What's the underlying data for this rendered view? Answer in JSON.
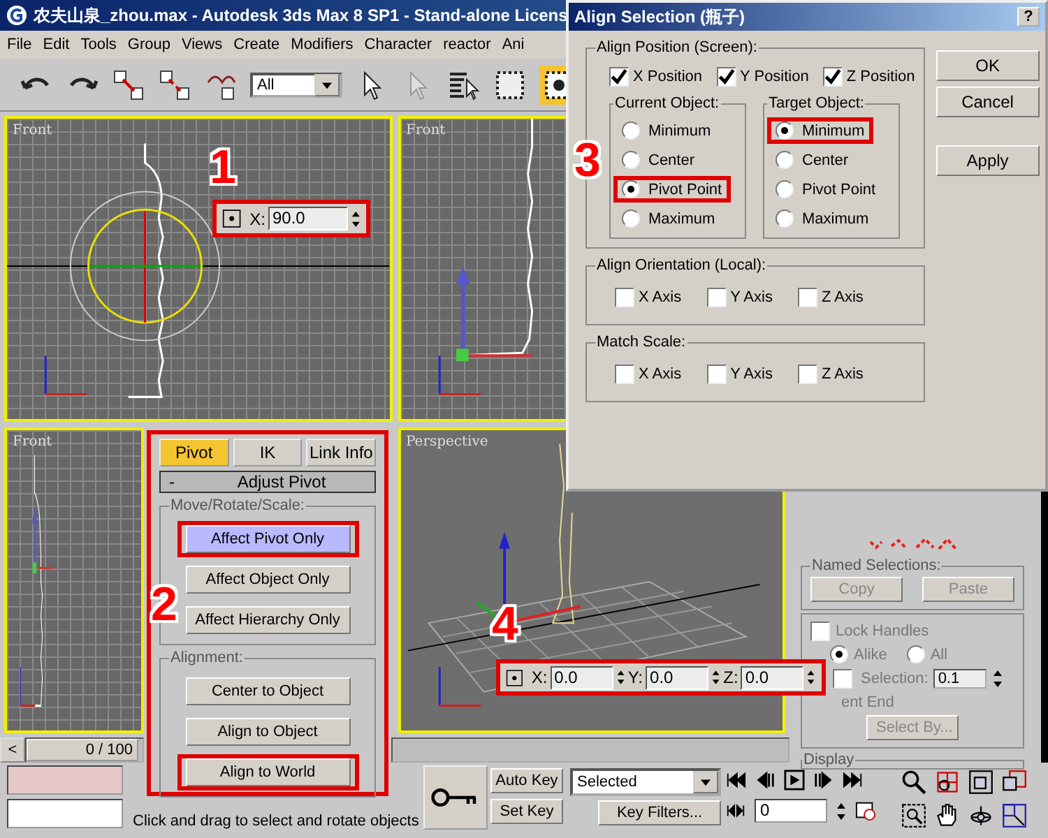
{
  "window": {
    "title": "农夫山泉_zhou.max - Autodesk 3ds Max 8 SP1  - Stand-alone Licens"
  },
  "menu": [
    "File",
    "Edit",
    "Tools",
    "Group",
    "Views",
    "Create",
    "Modifiers",
    "Character",
    "reactor",
    "Ani"
  ],
  "toolbar": {
    "selection_filter": "All"
  },
  "viewports": [
    {
      "label": "Front",
      "kind": "rotate"
    },
    {
      "label": "Front",
      "kind": "side"
    },
    {
      "label": "Front",
      "kind": "pivot"
    },
    {
      "label": "Perspective",
      "kind": "perspective"
    }
  ],
  "rotate_typein": {
    "axis": "X:",
    "value": "90.0",
    "highlighted": true
  },
  "move_typein": {
    "highlighted": true,
    "fields": [
      {
        "axis": "X:",
        "value": "0.0"
      },
      {
        "axis": "Y:",
        "value": "0.0"
      },
      {
        "axis": "Z:",
        "value": "0.0"
      }
    ]
  },
  "hierarchy_panel": {
    "highlighted": true,
    "tabs": [
      {
        "label": "Pivot",
        "selected": true
      },
      {
        "label": "IK",
        "selected": false
      },
      {
        "label": "Link Info",
        "selected": false
      }
    ],
    "rollout": {
      "toggle": "-",
      "title": "Adjust Pivot"
    },
    "groups": [
      {
        "title": "Move/Rotate/Scale:",
        "buttons": [
          {
            "label": "Affect Pivot Only",
            "on": true,
            "highlighted": true
          },
          {
            "label": "Affect Object Only",
            "on": false,
            "highlighted": false
          },
          {
            "label": "Affect Hierarchy Only",
            "on": false,
            "highlighted": false
          }
        ]
      },
      {
        "title": "Alignment:",
        "buttons": [
          {
            "label": "Center to Object",
            "on": false,
            "highlighted": false
          },
          {
            "label": "Align to Object",
            "on": false,
            "highlighted": false
          },
          {
            "label": "Align to World",
            "on": false,
            "highlighted": true
          }
        ]
      }
    ]
  },
  "time_slider": {
    "prev": "<",
    "reading": "0 / 100"
  },
  "status": {
    "prompt": "Click and drag to select and rotate objects"
  },
  "animation": {
    "auto_key": "Auto Key",
    "set_key": "Set Key",
    "key_mode": "Selected",
    "key_filters": "Key Filters...",
    "frame": "0"
  },
  "command_panel": {
    "named_selections": {
      "title": "Named Selections:",
      "copy": "Copy",
      "paste": "Paste"
    },
    "lock_handles": {
      "label": "Lock Handles",
      "checked": false
    },
    "handles_mode": [
      {
        "label": "Alike",
        "selected": true
      },
      {
        "label": "All",
        "selected": false
      }
    ],
    "area_selection": {
      "label": "Selection:",
      "checked": false,
      "value": "0.1"
    },
    "segment_end": "ent End",
    "select_by": "Select By...",
    "display_title": "Display"
  },
  "dialog": {
    "title": "Align Selection (瓶子)",
    "help": "?",
    "position": {
      "title": "Align Position (Screen):",
      "axes": [
        {
          "label": "X Position",
          "checked": true
        },
        {
          "label": "Y Position",
          "checked": true
        },
        {
          "label": "Z Position",
          "checked": true
        }
      ],
      "current": {
        "title": "Current Object:",
        "options": [
          {
            "label": "Minimum",
            "selected": false,
            "highlighted": false
          },
          {
            "label": "Center",
            "selected": false,
            "highlighted": false
          },
          {
            "label": "Pivot Point",
            "selected": true,
            "highlighted": true
          },
          {
            "label": "Maximum",
            "selected": false,
            "highlighted": false
          }
        ]
      },
      "target": {
        "title": "Target Object:",
        "options": [
          {
            "label": "Minimum",
            "selected": true,
            "highlighted": true
          },
          {
            "label": "Center",
            "selected": false,
            "highlighted": false
          },
          {
            "label": "Pivot Point",
            "selected": false,
            "highlighted": false
          },
          {
            "label": "Maximum",
            "selected": false,
            "highlighted": false
          }
        ]
      }
    },
    "orientation": {
      "title": "Align Orientation (Local):",
      "axes": [
        {
          "label": "X Axis",
          "checked": false
        },
        {
          "label": "Y Axis",
          "checked": false
        },
        {
          "label": "Z Axis",
          "checked": false
        }
      ]
    },
    "scale": {
      "title": "Match Scale:",
      "axes": [
        {
          "label": "X Axis",
          "checked": false
        },
        {
          "label": "Y Axis",
          "checked": false
        },
        {
          "label": "Z Axis",
          "checked": false
        }
      ]
    },
    "buttons": [
      "OK",
      "Cancel",
      "Apply"
    ]
  },
  "annotations": [
    {
      "label": "1"
    },
    {
      "label": "2"
    },
    {
      "label": "3"
    },
    {
      "label": "4"
    }
  ]
}
